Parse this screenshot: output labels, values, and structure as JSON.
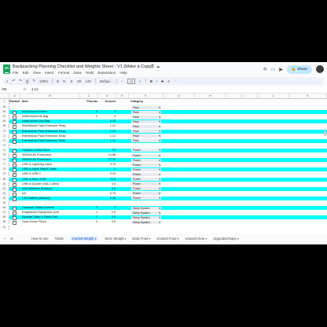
{
  "doc": {
    "title": "Backpacking Planning Checklist and Weights Sheet - V1 (Make a Copy)",
    "menus": [
      "File",
      "Edit",
      "View",
      "Insert",
      "Format",
      "Data",
      "Tools",
      "Extensions",
      "Help"
    ],
    "share_label": "Share"
  },
  "toolbar": {
    "zoom": "100%",
    "currency": "$",
    "percent": "%",
    "dec_less": ".0",
    "dec_more": ".00",
    "num_fmt": "123",
    "font": "Defaul...",
    "font_size": "10",
    "bold": "B",
    "italic": "I",
    "strike": "S",
    "text_color": "A"
  },
  "formula": {
    "ref": "D6",
    "value": "2.12"
  },
  "columns": [
    "A",
    "B",
    "C",
    "D",
    "E",
    "F",
    "G",
    "H",
    "I",
    "J",
    "K"
  ],
  "header_row": {
    "num": "1",
    "packed": "Packed",
    "item": "Item",
    "lbs": "Pounds",
    "oz": "Ounces",
    "category": "Category"
  },
  "rows": [
    {
      "n": "65",
      "item": "",
      "lbs": "",
      "oz": "",
      "cat": "Pack",
      "cyan": false,
      "cb": false
    },
    {
      "n": "66",
      "item": "Initial Ascent Frame",
      "lbs": "0",
      "oz": "3",
      "cat": "Pack",
      "cyan": true,
      "cb": true
    },
    {
      "n": "67",
      "item": "Initial Ascent 8k Bag",
      "lbs": "2",
      "oz": "3",
      "cat": "Pack",
      "cyan": false,
      "cb": true
    },
    {
      "n": "68",
      "item": "Initial Ascent Dry Bag",
      "lbs": "",
      "oz": "0.25",
      "cat": "Pack",
      "cyan": true,
      "cb": true
    },
    {
      "n": "69",
      "item": "Eberlestock Pack Extension Strap",
      "lbs": "",
      "oz": "1.12",
      "cat": "Pack",
      "cyan": false,
      "cb": true
    },
    {
      "n": "70",
      "item": "Eberlestock Pack Extension Strap",
      "lbs": "",
      "oz": "1.12",
      "cat": "Pack",
      "cyan": true,
      "cb": true
    },
    {
      "n": "71",
      "item": "Eberlestock Pack Extension Strap",
      "lbs": "",
      "oz": "1.12",
      "cat": "Pack",
      "cyan": false,
      "cb": true
    },
    {
      "n": "72",
      "item": "Eberlestock Pack Extension Strap",
      "lbs": "",
      "oz": "1.12",
      "cat": "Pack",
      "cyan": true,
      "cb": true
    },
    {
      "n": "73",
      "item": "",
      "lbs": "",
      "oz": "",
      "cat": "",
      "cyan": false,
      "cb": false
    },
    {
      "n": "74",
      "item": "GoalZero Solar Panel",
      "lbs": "",
      "oz": "13",
      "cat": "Power",
      "cyan": true,
      "cb": true
    },
    {
      "n": "75",
      "item": "30000mAh Powerbank",
      "lbs": "",
      "oz": "14.88",
      "cat": "Power",
      "cyan": false,
      "cb": true
    },
    {
      "n": "76",
      "item": "36000mAh Powerbank",
      "lbs": "",
      "oz": "17.25",
      "cat": "Power",
      "cyan": true,
      "cb": true
    },
    {
      "n": "77",
      "item": "USB to Lightning Cable",
      "lbs": "",
      "oz": "0.75",
      "cat": "Power",
      "cyan": false,
      "cb": true
    },
    {
      "n": "78",
      "item": "USB to Apple Watch Cable",
      "lbs": "",
      "oz": "1",
      "cat": "Power",
      "cyan": true,
      "cb": true
    },
    {
      "n": "79",
      "item": "USB to USB-C",
      "lbs": "",
      "oz": "0.25",
      "cat": "Power",
      "cyan": false,
      "cb": true
    },
    {
      "n": "80",
      "item": "USB to Micro USB",
      "lbs": "",
      "oz": "0.25",
      "cat": "Power",
      "cyan": true,
      "cb": true
    },
    {
      "n": "81",
      "item": "USB to Double USB-C (Mini)",
      "lbs": "",
      "oz": "0.5",
      "cat": "Power",
      "cyan": false,
      "cb": true
    },
    {
      "n": "82",
      "item": "AAA Batteries (Backup)",
      "lbs": "",
      "oz": "0.5",
      "cat": "Power",
      "cyan": true,
      "cb": true
    },
    {
      "n": "83",
      "item": "AA",
      "lbs": "",
      "oz": "0.75",
      "cat": "Power",
      "cyan": false,
      "cb": true
    },
    {
      "n": "84",
      "item": "CR2 Battery (Backup)",
      "lbs": "",
      "oz": "0.38",
      "cat": "Power",
      "cyan": true,
      "cb": true
    },
    {
      "n": "85",
      "item": "",
      "lbs": "",
      "oz": "",
      "cat": "",
      "cyan": false,
      "cb": false
    },
    {
      "n": "86",
      "item": "Cascade Outlaw Summit",
      "lbs": "2",
      "oz": "3",
      "cat": "Sleep System",
      "cyan": true,
      "cb": true
    },
    {
      "n": "87",
      "item": "Enlightened Equipment Quilt",
      "lbs": "1",
      "oz": "2.5",
      "cat": "Sleep System",
      "cyan": false,
      "cb": true
    },
    {
      "n": "88",
      "item": "Klymate Static V Sleep Pad",
      "lbs": "1",
      "oz": "2.5",
      "cat": "Sleep System",
      "cyan": true,
      "cb": true
    },
    {
      "n": "89",
      "item": "Gear Doctor Pillow",
      "lbs": "0",
      "oz": "3.5",
      "cat": "Sleep System",
      "cyan": false,
      "cb": true
    },
    {
      "n": "90",
      "item": "",
      "lbs": "",
      "oz": "",
      "cat": "",
      "cyan": false,
      "cb": false
    }
  ],
  "sheets": {
    "add": "+",
    "tabs": [
      {
        "label": "Totals",
        "active": false
      },
      {
        "label": "Carried Weight",
        "active": true
      },
      {
        "label": "Worn Weight",
        "active": false
      },
      {
        "label": "Daily Food",
        "active": false
      },
      {
        "label": "Unused Food",
        "active": false
      },
      {
        "label": "Unused Gear",
        "active": false
      },
      {
        "label": "Upgrades/Gaps",
        "active": false
      }
    ],
    "how_to_use": "How to Use"
  }
}
